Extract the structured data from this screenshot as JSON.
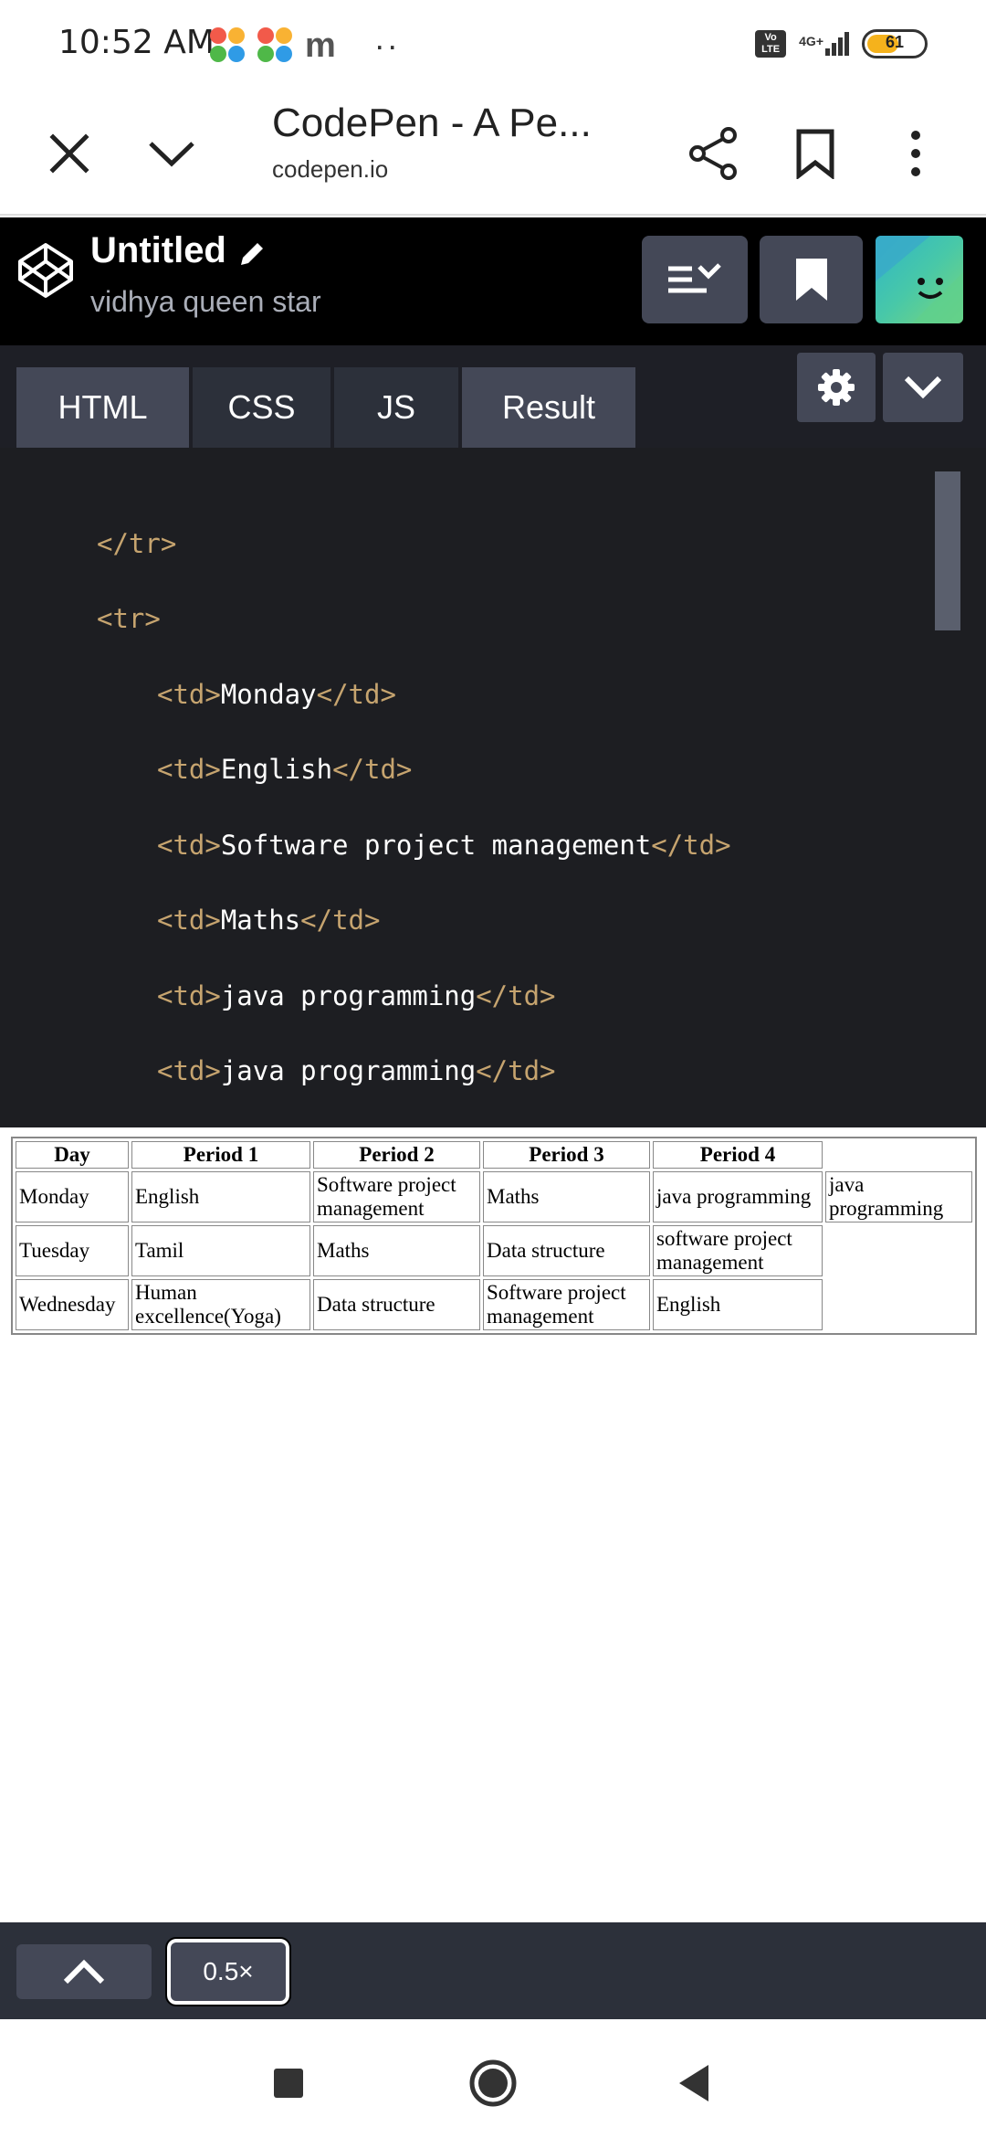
{
  "status_bar": {
    "time": "10:52 AM",
    "network_label": "4G+",
    "volte_label": "Vo LTE",
    "battery_percent": "61",
    "battery_level": 0.61,
    "app_icons": [
      "petal-app-icon",
      "petal-app-icon",
      "m-app-icon",
      "more-notifications-icon"
    ]
  },
  "browser": {
    "page_title": "CodePen - A Pe...",
    "url": "codepen.io",
    "buttons": [
      "close-icon",
      "chevron-down-icon",
      "share-icon",
      "bookmark-icon",
      "more-vert-icon"
    ]
  },
  "codepen": {
    "pen_title": "Untitled",
    "author": "vidhya queen star",
    "header_buttons": [
      "change-view-icon",
      "bookmark-icon",
      "avatar"
    ]
  },
  "editor": {
    "tabs": [
      {
        "label": "HTML",
        "active": true
      },
      {
        "label": "CSS",
        "active": false
      },
      {
        "label": "JS",
        "active": false
      },
      {
        "label": "Result",
        "active": true
      }
    ],
    "code_lines": [
      {
        "open": "</tr>",
        "text": "",
        "close": ""
      },
      {
        "open": "<tr>",
        "text": "",
        "close": ""
      },
      {
        "open": "<td>",
        "text": "Monday",
        "close": "</td>"
      },
      {
        "open": "<td>",
        "text": "English",
        "close": "</td>"
      },
      {
        "open": "<td>",
        "text": "Software project management",
        "close": "</td>"
      },
      {
        "open": "<td>",
        "text": "Maths",
        "close": "</td>"
      },
      {
        "open": "<td>",
        "text": "java programming",
        "close": "</td>"
      },
      {
        "open": "<td>",
        "text": "java programming",
        "close": "</td>"
      }
    ],
    "colors": {
      "tag": "#c6a46f",
      "text": "#ffffff",
      "background": "#1d1e22"
    }
  },
  "result": {
    "headers": [
      "Day",
      "Period 1",
      "Period 2",
      "Period 3",
      "Period 4",
      ""
    ],
    "rows": [
      [
        "Monday",
        "English",
        "Software project management",
        "Maths",
        "java programming",
        "java programming"
      ],
      [
        "Tuesday",
        "Tamil",
        "Maths",
        "Data structure",
        "software project management"
      ],
      [
        "Wednesday",
        "Human excellence(Yoga)",
        "Data structure",
        "Software project management",
        "English"
      ]
    ]
  },
  "bottom_bar": {
    "zoom_label": "0.5×"
  },
  "nav_bar": {
    "buttons": [
      "recents-icon",
      "home-icon",
      "back-icon"
    ]
  }
}
